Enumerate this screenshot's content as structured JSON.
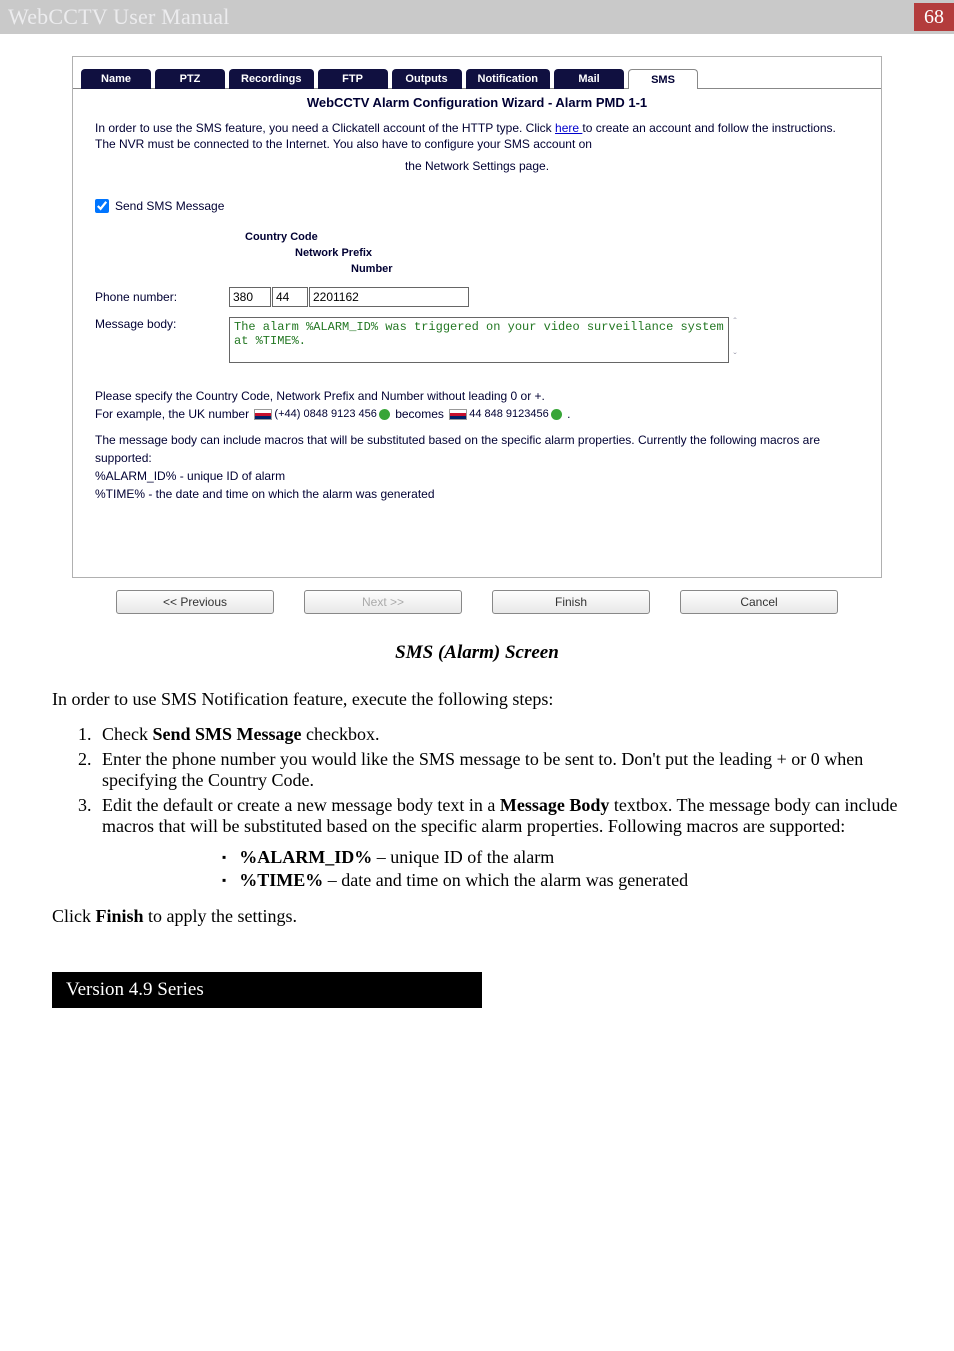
{
  "top": {
    "left": "WebCCTV User Manual",
    "page": "68"
  },
  "tabs": {
    "name": "Name",
    "ptz": "PTZ",
    "rec": "Recordings",
    "ftp": "FTP",
    "out": "Outputs",
    "notif": "Notification",
    "mail": "Mail",
    "sms": "SMS"
  },
  "wiz": {
    "title": "WebCCTV Alarm Configuration Wizard - Alarm PMD 1-1",
    "intro1a": "In order to use the SMS feature, you need a Clickatell account of the HTTP type. Click ",
    "intro1_link": "here ",
    "intro1b": "to create an account and follow the instructions. The NVR must be connected to the Internet. You also have to configure your SMS account on",
    "intro2": "the Network Settings page.",
    "send_sms_lbl": "Send SMS Message",
    "col_cc": "Country Code",
    "col_np": "Network Prefix",
    "col_num": "Number",
    "phone_lbl": "Phone number:",
    "phone_cc": "380",
    "phone_np": "44",
    "phone_num": "2201162",
    "msg_lbl": "Message body:",
    "msg_val": "The alarm %ALARM_ID% was triggered on your video surveillance system at %TIME%.",
    "help1": "Please specify the Country Code, Network Prefix and Number without leading 0 or +.",
    "help2a": "For example, the UK number ",
    "help2b": " (+44) 0848 9123 456 ",
    "help2c": " becomes ",
    "help2d": " 44 848 9123456 ",
    "help2e": ".",
    "help3": "The message body can include macros that will be substituted based on the specific alarm properties. Currently the following macros are supported:",
    "help4": "%ALARM_ID% - unique ID of alarm",
    "help5": "%TIME% - the date and time on which the alarm was generated"
  },
  "btns": {
    "prev": "<< Previous",
    "next": "Next >>",
    "finish": "Finish",
    "cancel": "Cancel"
  },
  "caption": "SMS (Alarm) Screen",
  "n1": "In order to use SMS Notification feature, execute the following steps:",
  "steps": {
    "s1a": "Check ",
    "s1b": "Send SMS Message",
    "s1c": " checkbox.",
    "s2": "Enter the phone number you would like the SMS message to be sent to. Don't put the leading + or 0 when specifying the Country Code.",
    "s3a": "Edit the default or create a new message body text in a ",
    "s3b": "Message Body",
    "s3c": " textbox. The message body can include macros that will be substituted based on the specific alarm properties. Following macros are supported:"
  },
  "macros": {
    "m1a": "%ALARM_ID%",
    "m1b": " – unique ID of the alarm",
    "m2a": "%TIME%",
    "m2b": " – date and time on which the alarm was generated"
  },
  "apply_a": "Click ",
  "apply_b": "Finish",
  "apply_c": " to apply the settings.",
  "footer": "Version 4.9 Series"
}
